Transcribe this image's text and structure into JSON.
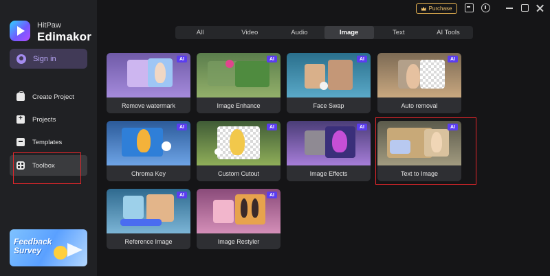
{
  "app": {
    "brand_small": "HitPaw",
    "brand_name": "Edimakor",
    "sign_in": "Sign in"
  },
  "sidebar": {
    "items": [
      {
        "label": "Create Project",
        "icon": "create-project-icon"
      },
      {
        "label": "Projects",
        "icon": "projects-icon"
      },
      {
        "label": "Templates",
        "icon": "templates-icon"
      },
      {
        "label": "Toolbox",
        "icon": "toolbox-icon",
        "active": true
      }
    ],
    "feedback": {
      "line1": "Feedback",
      "line2": "Survey"
    }
  },
  "topbar": {
    "purchase": "Purchase"
  },
  "tabs": [
    {
      "label": "All"
    },
    {
      "label": "Video"
    },
    {
      "label": "Audio"
    },
    {
      "label": "Image",
      "active": true
    },
    {
      "label": "Text"
    },
    {
      "label": "AI Tools"
    }
  ],
  "tools": [
    {
      "label": "Remove watermark",
      "badge": "AI"
    },
    {
      "label": "Image Enhance",
      "badge": "AI"
    },
    {
      "label": "Face Swap",
      "badge": "AI"
    },
    {
      "label": "Auto removal",
      "badge": "AI"
    },
    {
      "label": "Chroma Key",
      "badge": "AI"
    },
    {
      "label": "Custom Cutout",
      "badge": "AI"
    },
    {
      "label": "Image Effects",
      "badge": "AI"
    },
    {
      "label": "Text to Image",
      "badge": "AI",
      "highlighted": true
    },
    {
      "label": "Reference Image",
      "badge": "AI"
    },
    {
      "label": "Image Restyler",
      "badge": "AI"
    }
  ],
  "colors": {
    "accent": "#5b3df0",
    "highlight_border": "#e4262b",
    "purchase": "#f2c46d"
  }
}
